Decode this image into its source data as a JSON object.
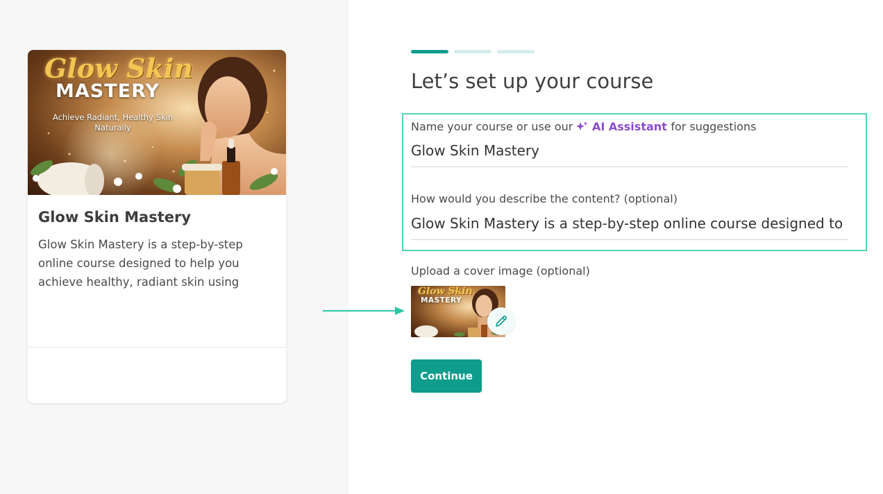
{
  "progress": {
    "steps": 3,
    "current_step": 1,
    "colors": {
      "active": "#0e9c8c",
      "inactive": "#d4ecea"
    }
  },
  "preview_card": {
    "image": {
      "script_title": "Glow Skin",
      "caps_title": "MASTERY",
      "subtitle_line1": "Achieve Radiant, Healthy Skin",
      "subtitle_line2": "Naturally"
    },
    "title": "Glow Skin Mastery",
    "description": "Glow Skin Mastery is a step-by-step online course designed to help you achieve healthy, radiant skin using simple, natural"
  },
  "form": {
    "heading": "Let’s set up your course",
    "name_label_prefix": "Name your course or use our",
    "ai_assistant_label": "AI Assistant",
    "name_label_suffix": "for suggestions",
    "name_value": "Glow Skin Mastery",
    "description_label": "How would you describe the content? (optional)",
    "description_value": "Glow Skin Mastery is a step-by-step online course designed to help you achieve healthy, radiant skin",
    "upload_label": "Upload a cover image (optional)",
    "thumbnail": {
      "script_title": "Glow Skin",
      "caps_title": "MASTERY"
    },
    "edit_icon": "pencil-icon",
    "continue_label": "Continue"
  },
  "colors": {
    "accent": "#0e9c8c",
    "highlight_border": "#4fd4b5",
    "ai_purple": "#8a4bd1",
    "left_bg": "#f7f7f7"
  }
}
